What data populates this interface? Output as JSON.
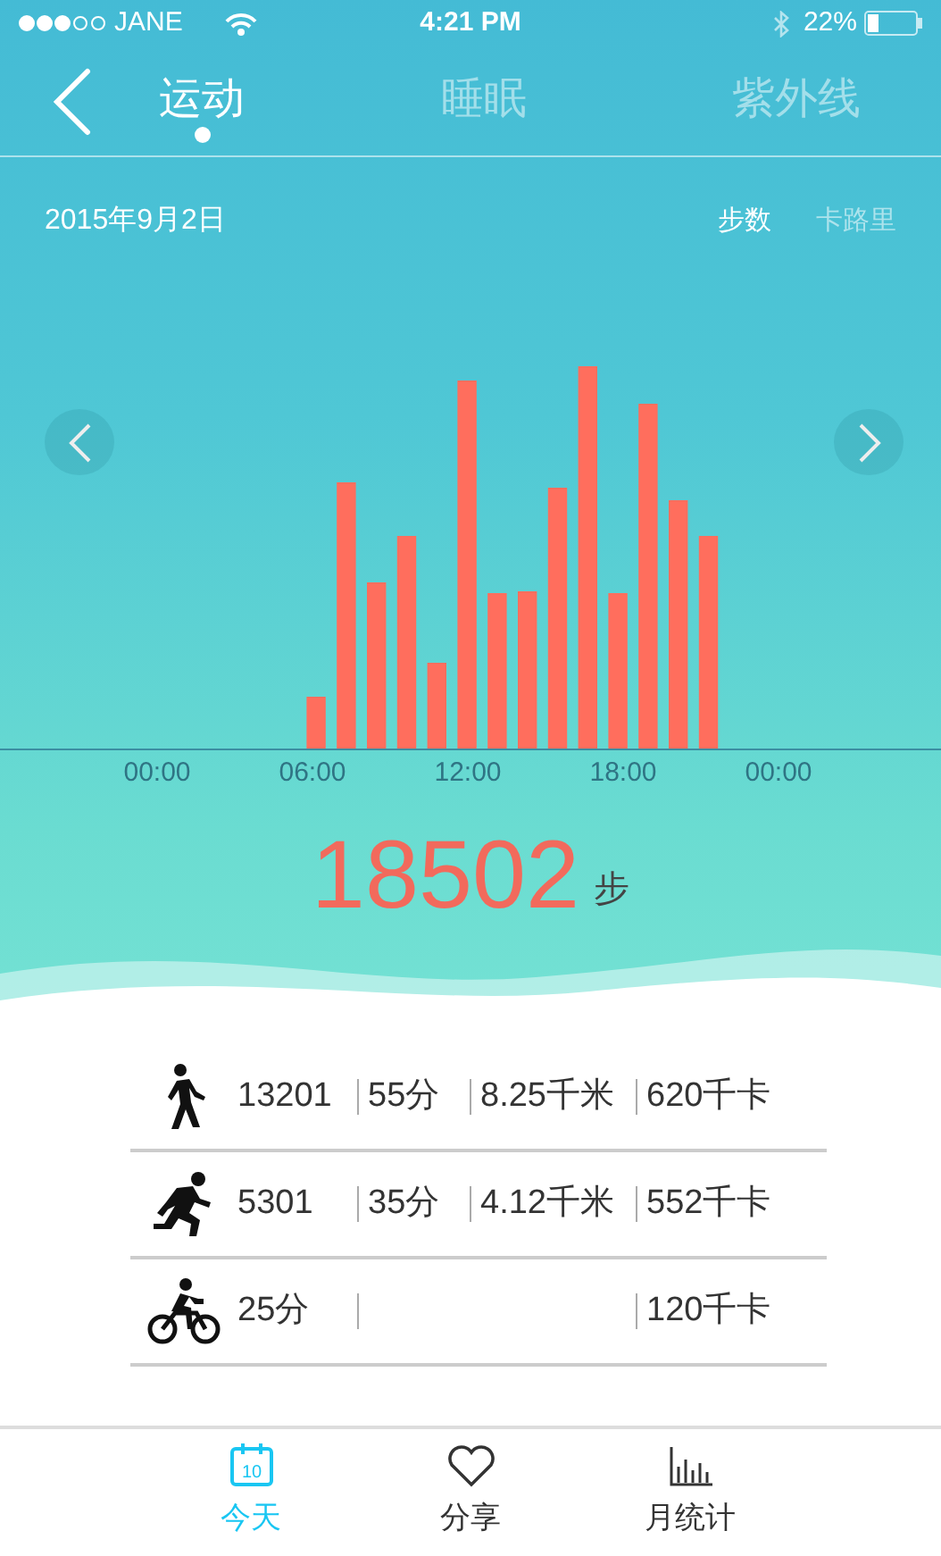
{
  "status_bar": {
    "carrier": "JANE",
    "time": "4:21 PM",
    "battery": "22%"
  },
  "tabs": [
    {
      "label": "运动",
      "selected": true
    },
    {
      "label": "睡眠",
      "selected": false
    },
    {
      "label": "紫外线",
      "selected": false
    }
  ],
  "date": "2015年9月2日",
  "metric_tabs": [
    {
      "label": "步数",
      "selected": true
    },
    {
      "label": "卡路里",
      "selected": false
    }
  ],
  "chart": {
    "axis_labels": [
      "00:00",
      "06:00",
      "12:00",
      "18:00",
      "00:00"
    ]
  },
  "total": {
    "value": "18502",
    "unit": "步"
  },
  "activities": [
    {
      "kind": "walk",
      "cells": [
        "13201",
        "55分",
        "8.25千米",
        "620千卡"
      ]
    },
    {
      "kind": "run",
      "cells": [
        "5301",
        "35分",
        "4.12千米",
        "552千卡"
      ]
    },
    {
      "kind": "bike",
      "cells": [
        "25分",
        null,
        null,
        "120千卡"
      ]
    }
  ],
  "bottom_tabs": [
    {
      "kind": "calendar",
      "label": "今天",
      "icon_text": "10",
      "selected": true
    },
    {
      "kind": "heart",
      "label": "分享",
      "selected": false
    },
    {
      "kind": "stats",
      "label": "月统计",
      "selected": false
    }
  ]
}
